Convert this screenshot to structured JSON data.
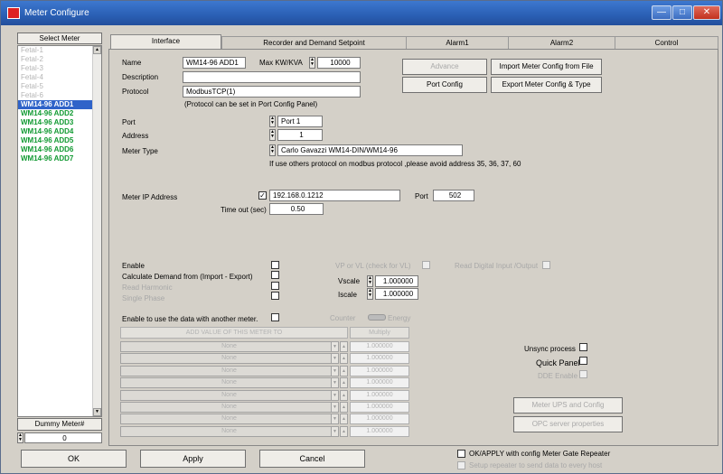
{
  "window": {
    "title": "Meter Configure",
    "min": "—",
    "max": "□",
    "close": "✕"
  },
  "left": {
    "select_meter": "Select Meter",
    "meters": [
      {
        "label": "Fetal-1",
        "state": "faded"
      },
      {
        "label": "Fetal-2",
        "state": "faded"
      },
      {
        "label": "Fetal-3",
        "state": "faded"
      },
      {
        "label": "Fetal-4",
        "state": "faded"
      },
      {
        "label": "Fetal-5",
        "state": "faded"
      },
      {
        "label": "Fetal-6",
        "state": "faded"
      },
      {
        "label": "WM14-96 ADD1",
        "state": "sel"
      },
      {
        "label": "WM14-96 ADD2",
        "state": "green"
      },
      {
        "label": "WM14-96 ADD3",
        "state": "green"
      },
      {
        "label": "WM14-96 ADD4",
        "state": "green"
      },
      {
        "label": "WM14-96 ADD5",
        "state": "green"
      },
      {
        "label": "WM14-96 ADD6",
        "state": "green"
      },
      {
        "label": "WM14-96 ADD7",
        "state": "green"
      }
    ],
    "dummy_meter": "Dummy Meter#",
    "dummy_value": "0"
  },
  "tabs": [
    "Interface",
    "Recorder and Demand Setpoint",
    "Alarm1",
    "Alarm2",
    "Control"
  ],
  "form": {
    "name_label": "Name",
    "name_value": "WM14-96 ADD1",
    "maxkw_label": "Max KW/KVA",
    "maxkw_value": "10000",
    "description_label": "Description",
    "description_value": "",
    "protocol_label": "Protocol",
    "protocol_value": "ModbusTCP(1)",
    "protocol_note": "(Protocol can be set in Port Config Panel)",
    "advance_btn": "Advance",
    "import_btn": "Import Meter Config from File",
    "portconfig_btn": "Port Config",
    "export_btn": "Export Meter Config & Type",
    "port_label": "Port",
    "port_value": "Port 1",
    "address_label": "Address",
    "address_value": "1",
    "metertype_label": "Meter Type",
    "metertype_value": "Carlo Gavazzi WM14-DIN/WM14-96",
    "metertype_note": "If use others protocol on modbus protocol ,please avoid address 35, 36, 37, 60",
    "ip_label": "Meter IP Address",
    "ip_checked": "✓",
    "ip_value": "192.168.0.1212",
    "ip_port_label": "Port",
    "ip_port_value": "502",
    "timeout_label": "Time out (sec)",
    "timeout_value": "0.50",
    "enable_label": "Enable",
    "calc_demand_label": "Calculate Demand from (Import - Export)",
    "read_harmonic_label": "Read Harmonic",
    "single_phase_label": "Single Phase",
    "vp_vl_label": "VP or VL (check for VL)",
    "read_digital_label": "Read Digital Input /Output",
    "vscale_label": "Vscale",
    "vscale_value": "1.000000",
    "iscale_label": "Iscale",
    "iscale_value": "1.000000",
    "enable_other_label": "Enable to use the data with another meter.",
    "counter_label": "Counter",
    "energy_label": "Energy",
    "add_value_header": "ADD VALUE OF THIS METER TO",
    "multiply_header": "Multiply",
    "rows": [
      {
        "name": "None",
        "mult": "1.000000"
      },
      {
        "name": "None",
        "mult": "1.000000"
      },
      {
        "name": "None",
        "mult": "1.000000"
      },
      {
        "name": "None",
        "mult": "1.000000"
      },
      {
        "name": "None",
        "mult": "1.000000"
      },
      {
        "name": "None",
        "mult": "1.000000"
      },
      {
        "name": "None",
        "mult": "1.000000"
      },
      {
        "name": "None",
        "mult": "1.000000"
      }
    ],
    "unsync_label": "Unsync process",
    "quick_panel_label": "Quick Panel",
    "dde_enable_label": "DDE Enable",
    "meter_ups_btn": "Meter UPS and Config",
    "opc_btn": "OPC server properties"
  },
  "bottom": {
    "ok_btn": "OK",
    "apply_btn": "Apply",
    "cancel_btn": "Cancel",
    "gate_repeater_label": "OK/APPLY with config Meter Gate Repeater",
    "setup_repeater_label": "Setup repeater to send data to every host"
  }
}
